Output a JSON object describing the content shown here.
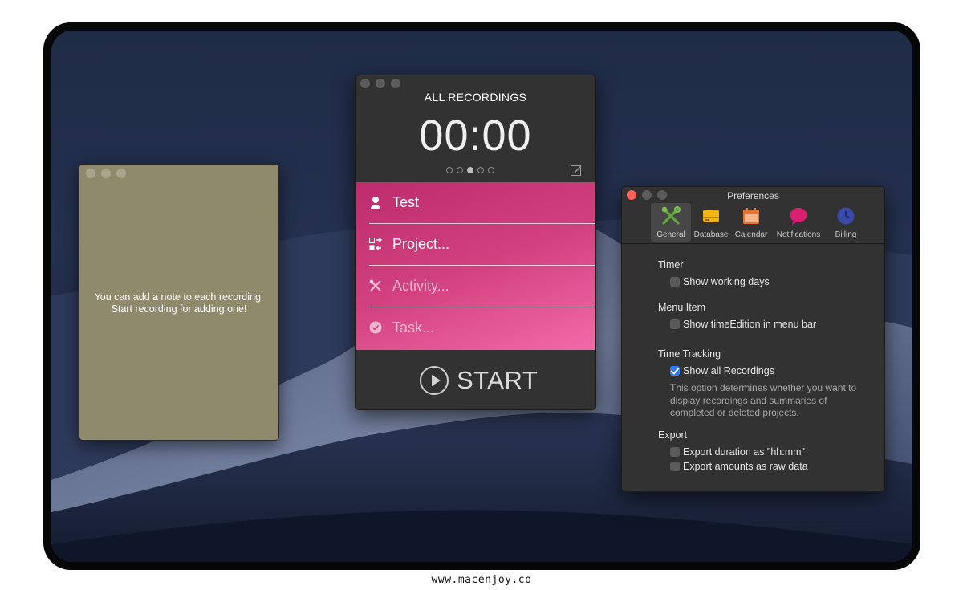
{
  "footer": {
    "url": "www.macenjoy.co"
  },
  "note_window": {
    "text_line1": "You can add a note to each recording.",
    "text_line2": "Start recording for adding one!"
  },
  "timer_window": {
    "title": "ALL RECORDINGS",
    "clock": "00:00",
    "page_count": 5,
    "active_page": 3,
    "rows": [
      {
        "label": "Test",
        "icon": "person-icon",
        "placeholder": false
      },
      {
        "label": "Project...",
        "icon": "project-icon",
        "placeholder": false
      },
      {
        "label": "Activity...",
        "icon": "tools-icon",
        "placeholder": true
      },
      {
        "label": "Task...",
        "icon": "check-circle-icon",
        "placeholder": true
      }
    ],
    "start_label": "START",
    "accent_color": "#d2417f"
  },
  "preferences_window": {
    "title": "Preferences",
    "toolbar": [
      {
        "label": "General",
        "icon": "tools-icon",
        "selected": true
      },
      {
        "label": "Database",
        "icon": "database-icon",
        "selected": false
      },
      {
        "label": "Calendar",
        "icon": "calendar-icon",
        "selected": false
      },
      {
        "label": "Notifications",
        "icon": "speech-bubble-icon",
        "selected": false
      },
      {
        "label": "Billing",
        "icon": "clock-icon",
        "selected": false
      }
    ],
    "sections": {
      "timer": {
        "heading": "Timer",
        "show_working_days": {
          "label": "Show working days",
          "checked": false
        }
      },
      "menu_item": {
        "heading": "Menu Item",
        "show_in_menu_bar": {
          "label": "Show timeEdition in menu bar",
          "checked": false
        }
      },
      "time_tracking": {
        "heading": "Time Tracking",
        "show_all_recordings": {
          "label": "Show all Recordings",
          "checked": true
        },
        "help_line1": "This option determines whether you want to",
        "help_line2": "display recordings and summaries of",
        "help_line3": "completed or deleted projects."
      },
      "export": {
        "heading": "Export",
        "duration_hhmm": {
          "label": "Export duration as \"hh:mm\"",
          "checked": false
        },
        "amounts_raw": {
          "label": "Export amounts as raw data",
          "checked": false
        }
      }
    }
  }
}
